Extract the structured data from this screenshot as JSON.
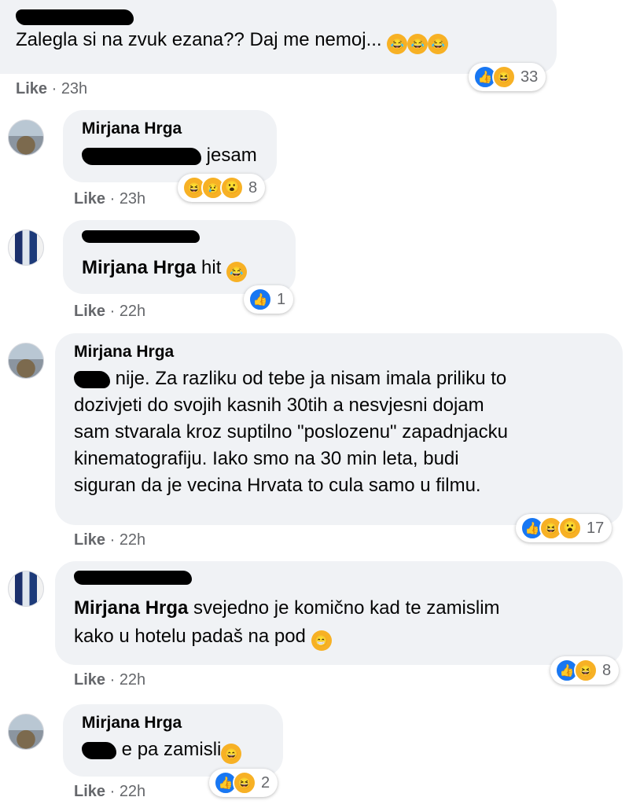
{
  "comments": [
    {
      "text": "Zalegla si na zvuk ezana?? Daj me nemoj...",
      "inline_emoji": [
        "😂",
        "😂",
        "😂"
      ],
      "like_label": "Like",
      "time": "23h",
      "reactions": {
        "icons": [
          "like-icon",
          "haha-icon"
        ],
        "count": "33"
      }
    },
    {
      "author": "Mirjana Hrga",
      "text": "jesam",
      "like_label": "Like",
      "time": "23h",
      "reactions": {
        "icons": [
          "haha-icon",
          "sad-icon",
          "wow-icon"
        ],
        "count": "8"
      }
    },
    {
      "mention": "Mirjana Hrga",
      "text": "hit",
      "inline_emoji": [
        "😂"
      ],
      "like_label": "Like",
      "time": "22h",
      "reactions": {
        "icons": [
          "like-icon"
        ],
        "count": "1"
      }
    },
    {
      "author": "Mirjana Hrga",
      "lines": [
        "nije. Za razliku od tebe ja nisam imala priliku to",
        "dozivjeti do svojih kasnih 30tih a nesvjesni dojam",
        "sam stvarala kroz suptilno \"poslozenu\" zapadnjacku",
        "kinematografiju. Iako smo na 30 min leta, budi",
        "siguran da je vecina Hrvata to cula samo u filmu."
      ],
      "like_label": "Like",
      "time": "22h",
      "reactions": {
        "icons": [
          "like-icon",
          "haha-icon",
          "wow-icon"
        ],
        "count": "17"
      }
    },
    {
      "mention": "Mirjana Hrga",
      "text_line1": "svejedno je komično kad te zamislim",
      "text_line2": "kako u hotelu padaš na pod",
      "inline_emoji": [
        "😁"
      ],
      "like_label": "Like",
      "time": "22h",
      "reactions": {
        "icons": [
          "like-icon",
          "haha-icon"
        ],
        "count": "8"
      }
    },
    {
      "author": "Mirjana Hrga",
      "text": "e pa zamisli",
      "inline_emoji": [
        "😄"
      ],
      "like_label": "Like",
      "time": "22h",
      "reactions": {
        "icons": [
          "like-icon",
          "haha-icon"
        ],
        "count": "2"
      }
    }
  ],
  "colors": {
    "bubble": "#f0f2f5",
    "meta": "#65676b",
    "like_blue": "#1877f2",
    "emoji_yellow": "#f7b125"
  }
}
